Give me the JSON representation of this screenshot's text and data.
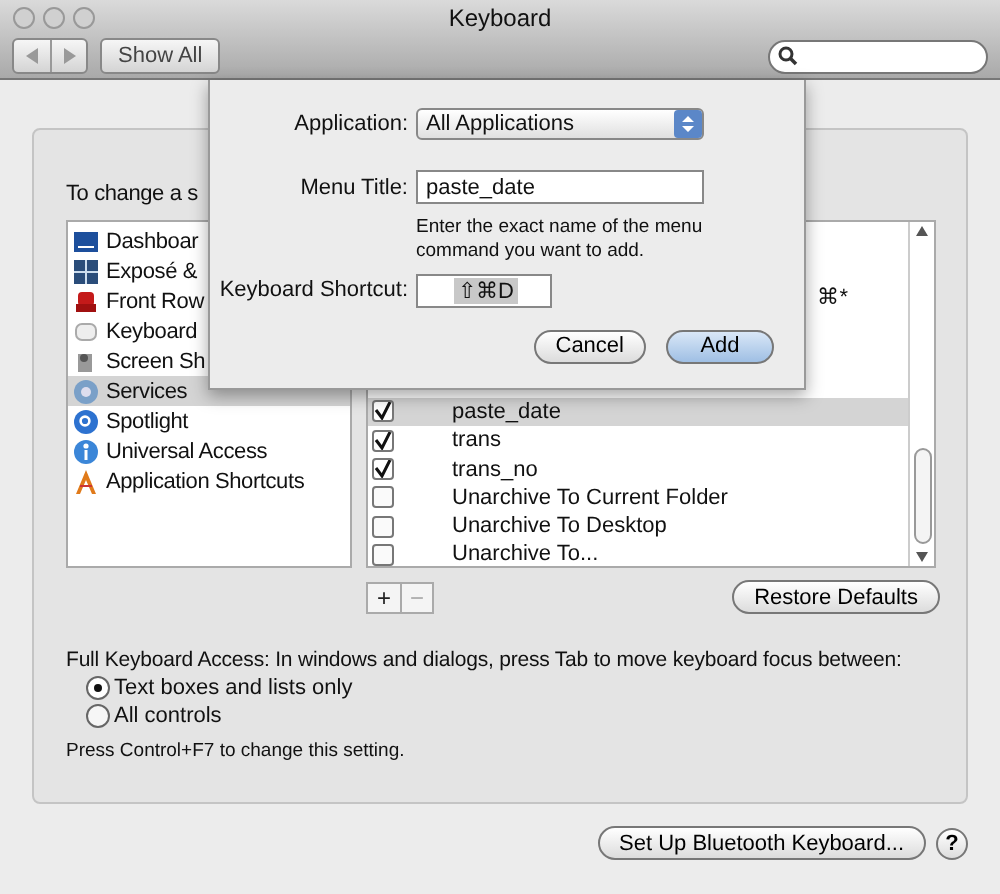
{
  "window": {
    "title": "Keyboard"
  },
  "toolbar": {
    "show_all": "Show All"
  },
  "instruction": "To change a s",
  "categories": [
    {
      "label": "Dashboar",
      "selected": false
    },
    {
      "label": "Exposé &",
      "selected": false
    },
    {
      "label": "Front Row",
      "selected": false
    },
    {
      "label": "Keyboard",
      "selected": false
    },
    {
      "label": "Screen Sh",
      "selected": false
    },
    {
      "label": "Services",
      "selected": true
    },
    {
      "label": "Spotlight",
      "selected": false
    },
    {
      "label": "Universal Access",
      "selected": false
    },
    {
      "label": "Application Shortcuts",
      "selected": false
    }
  ],
  "services": [
    {
      "kind": "covered"
    },
    {
      "kind": "covered"
    },
    {
      "kind": "covered",
      "shortcut": "⌘*"
    },
    {
      "kind": "covered"
    },
    {
      "kind": "covered"
    },
    {
      "kind": "covered"
    },
    {
      "kind": "item",
      "name": "paste_date",
      "checked": true,
      "selected": true
    },
    {
      "kind": "item",
      "name": "trans",
      "checked": true,
      "selected": false
    },
    {
      "kind": "item",
      "name": "trans_no",
      "checked": true,
      "selected": false
    },
    {
      "kind": "item",
      "name": "Unarchive To Current Folder",
      "checked": false,
      "selected": false
    },
    {
      "kind": "item",
      "name": "Unarchive To Desktop",
      "checked": false,
      "selected": false
    },
    {
      "kind": "item",
      "name": "Unarchive To...",
      "checked": false,
      "selected": false
    }
  ],
  "list_buttons": [
    "+",
    "−"
  ],
  "restore": "Restore Defaults",
  "full_access": {
    "label": "Full Keyboard Access: In windows and dialogs, press Tab to move keyboard focus between:",
    "options": [
      {
        "label": "Text boxes and lists only",
        "selected": true
      },
      {
        "label": "All controls",
        "selected": false
      }
    ],
    "note": "Press Control+F7 to change this setting."
  },
  "bluetooth": "Set Up Bluetooth Keyboard...",
  "help": "?",
  "sheet": {
    "application_label": "Application:",
    "application": "All Applications",
    "menu_title_label": "Menu Title:",
    "menu_title": "paste_date",
    "hint": "Enter the exact name of the menu command you want to add.",
    "shortcut_label": "Keyboard Shortcut:",
    "shortcut": "⇧⌘D",
    "cancel": "Cancel",
    "add": "Add"
  }
}
